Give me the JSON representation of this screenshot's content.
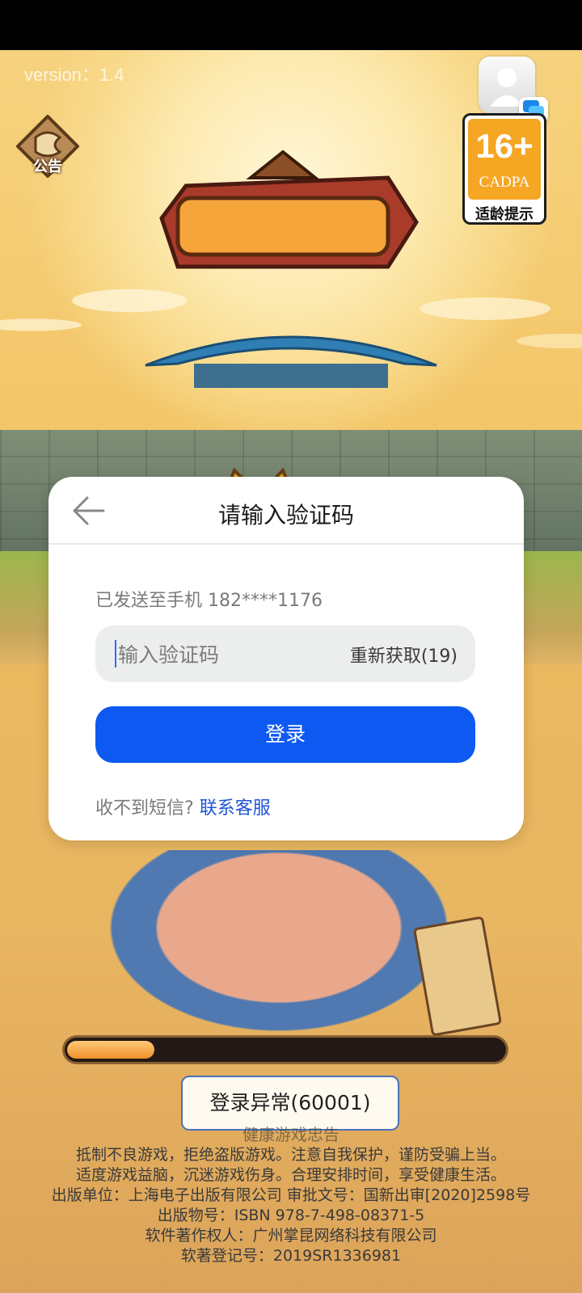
{
  "top": {
    "version": "version：1.4",
    "notice_label": "公告",
    "age_badge": {
      "rating": "16+",
      "org": "CADPA",
      "tip": "适龄提示"
    }
  },
  "logo_icon": "game-logo-shouhuzhijing",
  "dialog": {
    "title": "请输入验证码",
    "sent_to": "已发送至手机 182****1176",
    "code_placeholder": "输入验证码",
    "resend_label": "重新获取(19)",
    "login_label": "登录",
    "no_sms_text": "收不到短信?",
    "contact_link": "联系客服"
  },
  "loading": {
    "progress": 0.2
  },
  "error_button": "登录异常(60001)",
  "footer": {
    "heading": "健康游戏忠告",
    "lines": [
      "抵制不良游戏，拒绝盗版游戏。注意自我保护，谨防受骗上当。",
      "适度游戏益脑，沉迷游戏伤身。合理安排时间，享受健康生活。",
      "出版单位：上海电子出版有限公司  审批文号：国新出审[2020]2598号",
      "出版物号：ISBN 978-7-498-08371-5",
      "软件著作权人：广州掌昆网络科技有限公司",
      "软著登记号：2019SR1336981"
    ]
  },
  "colors": {
    "primary_button": "#0e59f2",
    "link": "#1f55d6",
    "age_badge": "#f5a623",
    "progress": "#f08f2a"
  }
}
